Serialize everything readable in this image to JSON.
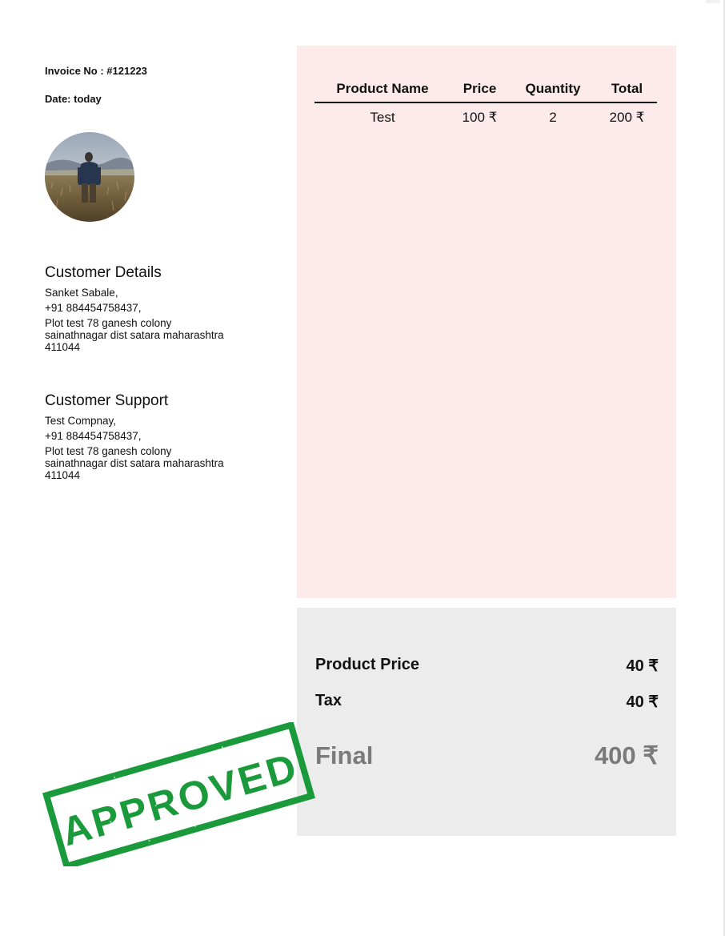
{
  "invoice": {
    "number_label": "Invoice No : #121223",
    "date_label": "Date: today"
  },
  "customer": {
    "title": "Customer Details",
    "name": "Sanket Sabale,",
    "phone": "+91 884454758437,",
    "address_line1": "Plot test 78 ganesh colony",
    "address_line2": "sainathnagar dist satara maharashtra",
    "pincode": "411044"
  },
  "support": {
    "title": "Customer Support",
    "name": "Test Compnay,",
    "phone": "+91 884454758437,",
    "address_line1": "Plot test 78 ganesh colony",
    "address_line2": "sainathnagar dist satara maharashtra",
    "pincode": "411044"
  },
  "products": {
    "headers": [
      "Product Name",
      "Price",
      "Quantity",
      "Total"
    ],
    "rows": [
      [
        "Test",
        "100 ₹",
        "2",
        "200 ₹"
      ]
    ]
  },
  "summary": {
    "product_price_label": "Product Price",
    "product_price_value": "40 ₹",
    "tax_label": "Tax",
    "tax_value": "40 ₹",
    "final_label": "Final",
    "final_value": "400 ₹"
  },
  "stamp": {
    "text": "APPROVED",
    "color": "#1a9a3a"
  },
  "colors": {
    "products_panel_bg": "#fdeaea",
    "summary_panel_bg": "#ececec",
    "final_text": "#7a7a7a"
  },
  "icons": {
    "avatar": "person-in-field-photo"
  }
}
